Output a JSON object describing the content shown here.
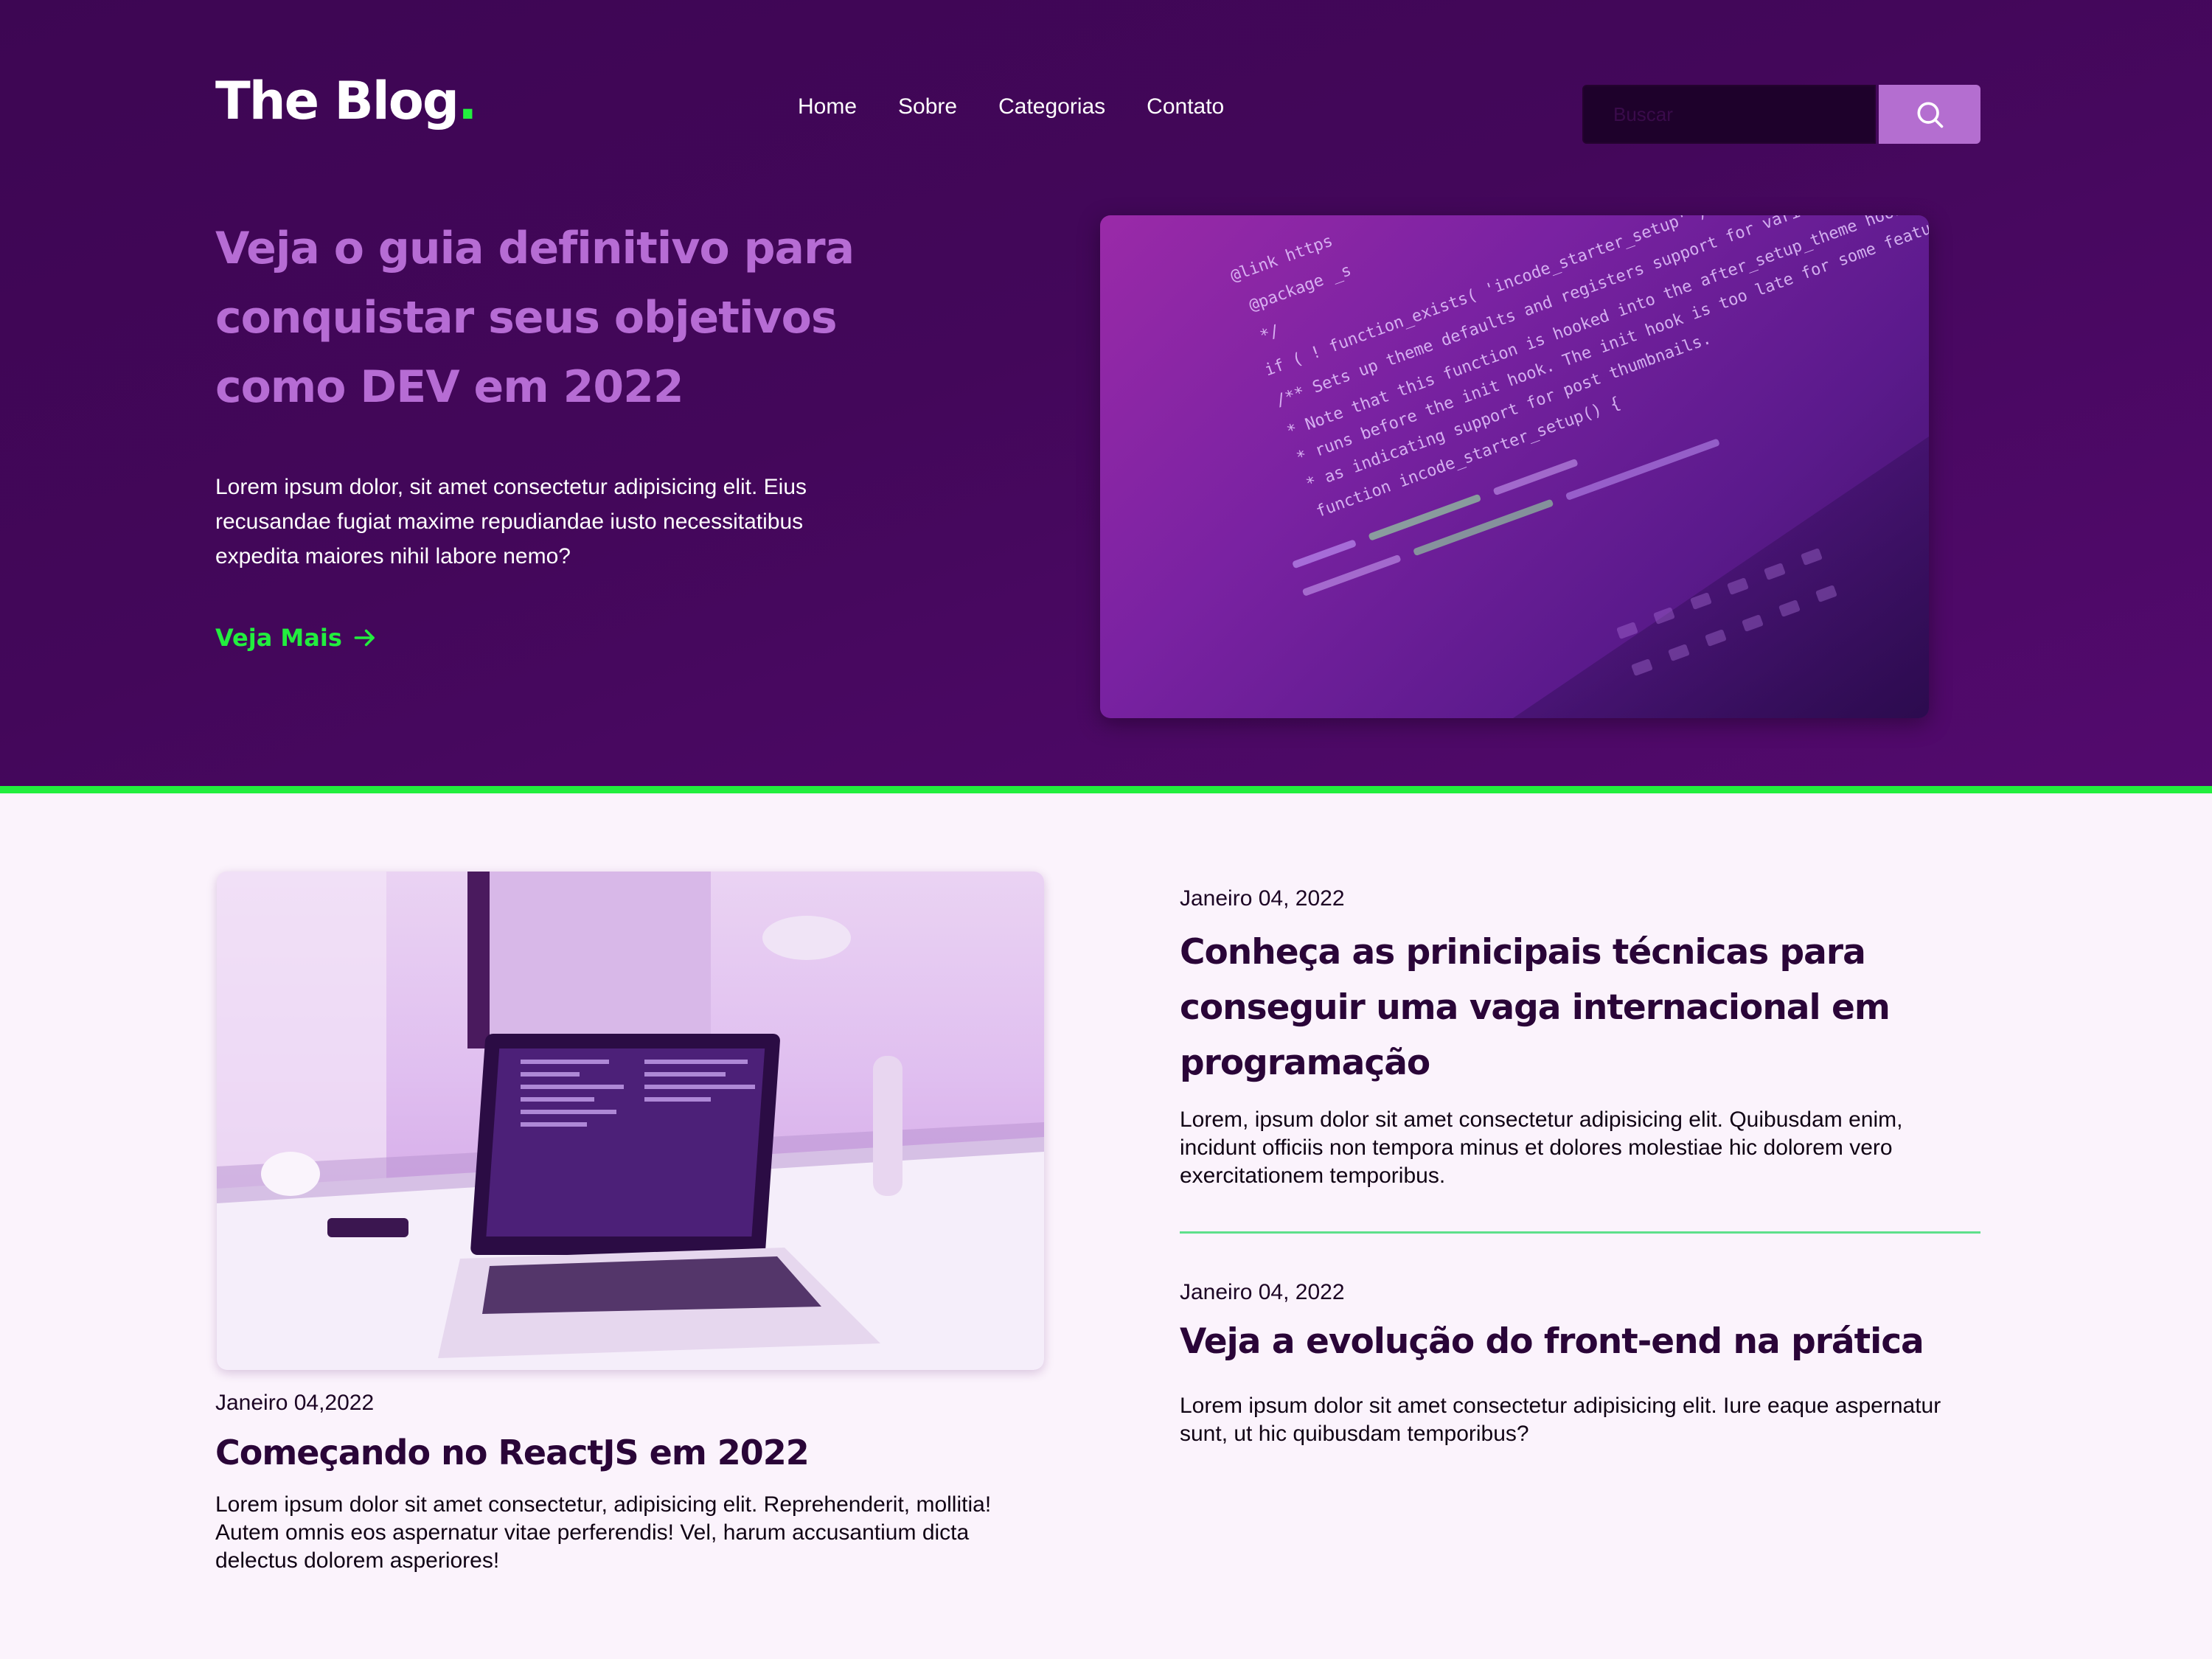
{
  "header": {
    "logo_text": "The Blog",
    "logo_dot": ".",
    "nav": [
      "Home",
      "Sobre",
      "Categorias",
      "Contato"
    ],
    "search_placeholder": "Buscar",
    "search_icon": "search-icon"
  },
  "hero": {
    "title": "Veja o guia definitivo para conquistar seus objetivos como DEV em 2022",
    "text": "Lorem ipsum dolor, sit amet consectetur adipisicing elit. Eius recusandae fugiat maxime repudiandae iusto necessitatibus expedita maiores nihil labore nemo?",
    "link_label": "Veja Mais",
    "link_icon": "arrow-right-icon",
    "code_lines": [
      "@link https",
      "@package _s",
      "*/",
      "if ( ! function_exists( 'incode_starter_setup' ) )",
      "/** Sets up theme defaults and registers support for various",
      " * Note that this function is hooked into the after_setup_theme hook",
      " * runs before the init hook. The init hook is too late for some features",
      " * as indicating support for post thumbnails.",
      "function incode_starter_setup() {"
    ]
  },
  "posts": {
    "featured": {
      "date": "Janeiro 04,2022",
      "title": "Começando no ReactJS em 2022",
      "excerpt": "Lorem ipsum dolor sit amet consectetur, adipisicing elit. Reprehenderit, mollitia! Autem omnis eos aspernatur vitae perferendis! Vel, harum accusantium dicta delectus dolorem asperiores!"
    },
    "side": [
      {
        "date": "Janeiro 04, 2022",
        "title": "Conheça as prinicipais técnicas para conseguir uma vaga internacional em programação",
        "excerpt": "Lorem, ipsum dolor sit amet consectetur adipisicing elit. Quibusdam enim, incidunt officiis non tempora minus et dolores molestiae hic dolorem vero exercitationem temporibus."
      },
      {
        "date": "Janeiro 04, 2022",
        "title": "Veja a evolução do front-end na prática",
        "excerpt": "Lorem ipsum dolor sit amet consectetur adipisicing elit. Iure eaque aspernatur sunt, ut hic quibusdam temporibus?"
      }
    ]
  },
  "colors": {
    "hero_bg": "#3d0653",
    "accent_green": "#22ee3e",
    "title_purple": "#b66cd4",
    "search_button": "#b46ed0",
    "post_title": "#2a0538",
    "page_bg": "#fbf3fc"
  }
}
